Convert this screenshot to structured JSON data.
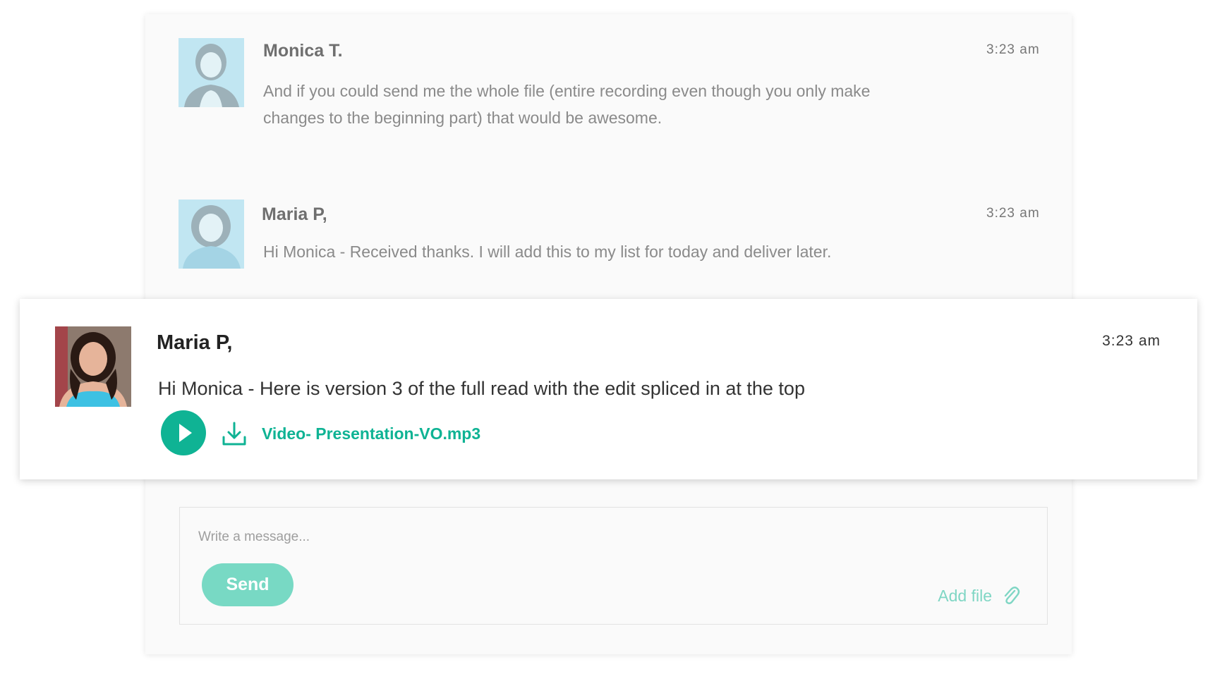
{
  "conversation": {
    "messages": [
      {
        "author": "Monica T.",
        "time": "3:23 am",
        "text": "And if you could send me the whole file (entire recording even though you only make changes to the beginning part) that would be awesome."
      },
      {
        "author": "Maria P,",
        "time": "3:23 am",
        "text": "Hi Monica - Received thanks. I will add this to my list for today and deliver later."
      }
    ],
    "highlighted": {
      "author": "Maria P,",
      "time": "3:23 am",
      "text": "Hi Monica - Here is version 3 of the full read with the edit spliced in at the top",
      "attachment": {
        "file_name": "Video- Presentation-VO.mp3",
        "play_icon": "play-icon",
        "download_icon": "download-icon"
      }
    }
  },
  "composer": {
    "placeholder": "Write a message...",
    "send_label": "Send",
    "add_file_label": "Add file",
    "attach_icon": "paperclip-icon"
  },
  "colors": {
    "accent": "#0fb394",
    "accent_light": "#78d9c4",
    "avatar_tint": "#7dd0ea"
  }
}
